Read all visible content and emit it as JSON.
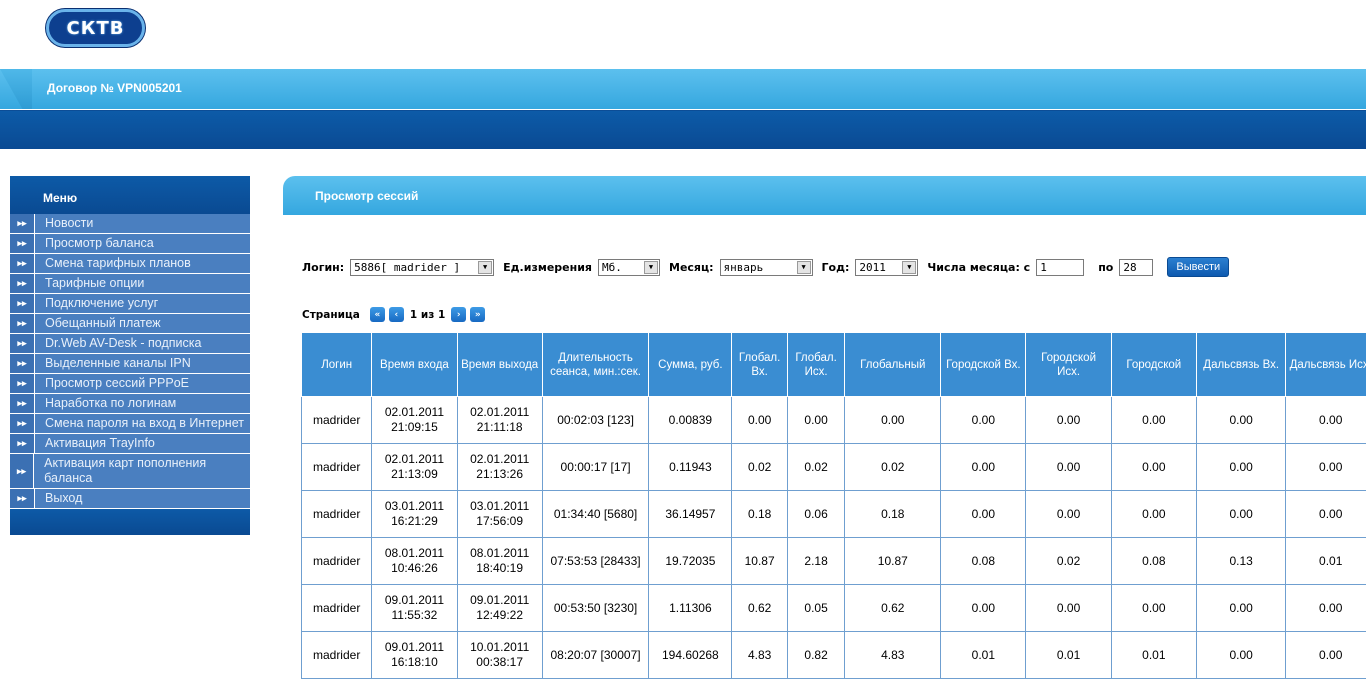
{
  "logo": {
    "text": "СКТВ"
  },
  "header": {
    "contract": "Договор № VPN005201"
  },
  "sidebar": {
    "title": "Меню",
    "items": [
      {
        "label": "Новости"
      },
      {
        "label": "Просмотр баланса"
      },
      {
        "label": "Смена тарифных планов"
      },
      {
        "label": "Тарифные опции"
      },
      {
        "label": "Подключение услуг"
      },
      {
        "label": "Обещанный платеж"
      },
      {
        "label": "Dr.Web AV-Desk - подписка"
      },
      {
        "label": "Выделенные каналы IPN"
      },
      {
        "label": "Просмотр сессий PPPoE"
      },
      {
        "label": "Наработка по логинам"
      },
      {
        "label": "Смена пароля на вход в Интернет"
      },
      {
        "label": "Активация TrayInfo"
      },
      {
        "label": "Активация карт пополнения баланса"
      },
      {
        "label": "Выход"
      }
    ]
  },
  "content": {
    "title": "Просмотр сессий"
  },
  "filters": {
    "login_label": "Логин:",
    "login_value": "5886[ madrider ]",
    "unit_label": "Ед.измерения",
    "unit_value": "Мб.",
    "month_label": "Месяц:",
    "month_value": "январь",
    "year_label": "Год:",
    "year_value": "2011",
    "days_label": "Числа месяца: с",
    "day_from": "1",
    "to_label": "по",
    "day_to": "28",
    "submit": "Вывести"
  },
  "pager": {
    "label": "Страница",
    "info": "1 из 1"
  },
  "table": {
    "columns": [
      "Логин",
      "Время входа",
      "Время выхода",
      "Длительность сеанса, мин.:сек.",
      "Сумма, руб.",
      "Глобал. Вх.",
      "Глобал. Исх.",
      "Глобальный",
      "Городской Вх.",
      "Городской Исх.",
      "Городской",
      "Дальсвязь Вх.",
      "Дальсвязь Исх."
    ],
    "rows": [
      [
        "madrider",
        "02.01.2011 21:09:15",
        "02.01.2011 21:11:18",
        "00:02:03 [123]",
        "0.00839",
        "0.00",
        "0.00",
        "0.00",
        "0.00",
        "0.00",
        "0.00",
        "0.00",
        "0.00"
      ],
      [
        "madrider",
        "02.01.2011 21:13:09",
        "02.01.2011 21:13:26",
        "00:00:17 [17]",
        "0.11943",
        "0.02",
        "0.02",
        "0.02",
        "0.00",
        "0.00",
        "0.00",
        "0.00",
        "0.00"
      ],
      [
        "madrider",
        "03.01.2011 16:21:29",
        "03.01.2011 17:56:09",
        "01:34:40 [5680]",
        "36.14957",
        "0.18",
        "0.06",
        "0.18",
        "0.00",
        "0.00",
        "0.00",
        "0.00",
        "0.00"
      ],
      [
        "madrider",
        "08.01.2011 10:46:26",
        "08.01.2011 18:40:19",
        "07:53:53 [28433]",
        "19.72035",
        "10.87",
        "2.18",
        "10.87",
        "0.08",
        "0.02",
        "0.08",
        "0.13",
        "0.01"
      ],
      [
        "madrider",
        "09.01.2011 11:55:32",
        "09.01.2011 12:49:22",
        "00:53:50 [3230]",
        "1.11306",
        "0.62",
        "0.05",
        "0.62",
        "0.00",
        "0.00",
        "0.00",
        "0.00",
        "0.00"
      ],
      [
        "madrider",
        "09.01.2011 16:18:10",
        "10.01.2011 00:38:17",
        "08:20:07 [30007]",
        "194.60268",
        "4.83",
        "0.82",
        "4.83",
        "0.01",
        "0.01",
        "0.01",
        "0.00",
        "0.00"
      ]
    ]
  }
}
